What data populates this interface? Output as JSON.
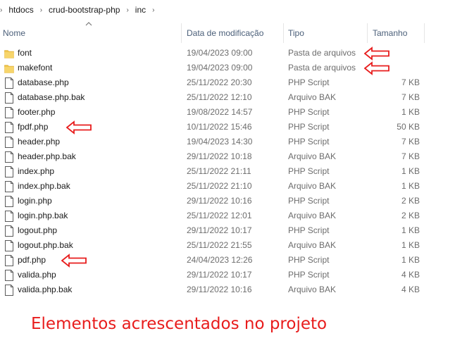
{
  "breadcrumb": [
    "htdocs",
    "crud-bootstrap-php",
    "inc"
  ],
  "columns": {
    "name": "Nome",
    "date": "Data de modificação",
    "type": "Tipo",
    "size": "Tamanho"
  },
  "files": [
    {
      "icon": "folder-icon",
      "name": "font",
      "date": "19/04/2023 09:00",
      "type": "Pasta de arquivos",
      "size": "",
      "arrow": true
    },
    {
      "icon": "folder-icon",
      "name": "makefont",
      "date": "19/04/2023 09:00",
      "type": "Pasta de arquivos",
      "size": "",
      "arrow": true
    },
    {
      "icon": "file-icon",
      "name": "database.php",
      "date": "25/11/2022 20:30",
      "type": "PHP Script",
      "size": "7 KB",
      "arrow": false
    },
    {
      "icon": "file-icon",
      "name": "database.php.bak",
      "date": "25/11/2022 12:10",
      "type": "Arquivo BAK",
      "size": "7 KB",
      "arrow": false
    },
    {
      "icon": "file-icon",
      "name": "footer.php",
      "date": "19/08/2022 14:57",
      "type": "PHP Script",
      "size": "1 KB",
      "arrow": false
    },
    {
      "icon": "file-icon",
      "name": "fpdf.php",
      "date": "10/11/2022 15:46",
      "type": "PHP Script",
      "size": "50 KB",
      "arrow": true
    },
    {
      "icon": "file-icon",
      "name": "header.php",
      "date": "19/04/2023 14:30",
      "type": "PHP Script",
      "size": "7 KB",
      "arrow": false
    },
    {
      "icon": "file-icon",
      "name": "header.php.bak",
      "date": "29/11/2022 10:18",
      "type": "Arquivo BAK",
      "size": "7 KB",
      "arrow": false
    },
    {
      "icon": "file-icon",
      "name": "index.php",
      "date": "25/11/2022 21:11",
      "type": "PHP Script",
      "size": "1 KB",
      "arrow": false
    },
    {
      "icon": "file-icon",
      "name": "index.php.bak",
      "date": "25/11/2022 21:10",
      "type": "Arquivo BAK",
      "size": "1 KB",
      "arrow": false
    },
    {
      "icon": "file-icon",
      "name": "login.php",
      "date": "29/11/2022 10:16",
      "type": "PHP Script",
      "size": "2 KB",
      "arrow": false
    },
    {
      "icon": "file-icon",
      "name": "login.php.bak",
      "date": "25/11/2022 12:01",
      "type": "Arquivo BAK",
      "size": "2 KB",
      "arrow": false
    },
    {
      "icon": "file-icon",
      "name": "logout.php",
      "date": "29/11/2022 10:17",
      "type": "PHP Script",
      "size": "1 KB",
      "arrow": false
    },
    {
      "icon": "file-icon",
      "name": "logout.php.bak",
      "date": "25/11/2022 21:55",
      "type": "Arquivo BAK",
      "size": "1 KB",
      "arrow": false
    },
    {
      "icon": "file-icon",
      "name": "pdf.php",
      "date": "24/04/2023 12:26",
      "type": "PHP Script",
      "size": "1 KB",
      "arrow": true
    },
    {
      "icon": "file-icon",
      "name": "valida.php",
      "date": "29/11/2022 10:17",
      "type": "PHP Script",
      "size": "4 KB",
      "arrow": false
    },
    {
      "icon": "file-icon",
      "name": "valida.php.bak",
      "date": "29/11/2022 10:16",
      "type": "Arquivo BAK",
      "size": "4 KB",
      "arrow": false
    }
  ],
  "annotation": {
    "caption": "Elementos acrescentados no projeto",
    "color": "#e81c1c"
  },
  "colors": {
    "folder": "#f0c64c",
    "header_text": "#4c607a",
    "secondary_text": "#6d6d6d"
  }
}
